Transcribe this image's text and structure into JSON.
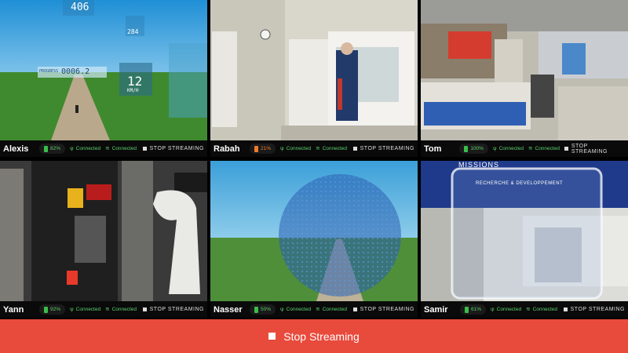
{
  "streams": [
    {
      "name": "Alexis",
      "battery": "82%",
      "battery_level": 0.82,
      "status_a": "Connected",
      "status_b": "Connected",
      "action": "STOP STREAMING"
    },
    {
      "name": "Rabah",
      "battery": "21%",
      "battery_level": 0.21,
      "status_a": "Connected",
      "status_b": "Connected",
      "action": "STOP STREAMING"
    },
    {
      "name": "Tom",
      "battery": "100%",
      "battery_level": 1.0,
      "status_a": "Connected",
      "status_b": "Connected",
      "action": "STOP STREAMING"
    },
    {
      "name": "Yann",
      "battery": "92%",
      "battery_level": 0.92,
      "status_a": "Connected",
      "status_b": "Connected",
      "action": "STOP STREAMING"
    },
    {
      "name": "Nasser",
      "battery": "50%",
      "battery_level": 0.5,
      "status_a": "Connected",
      "status_b": "Connected",
      "action": "STOP STREAMING"
    },
    {
      "name": "Samir",
      "battery": "61%",
      "battery_level": 0.61,
      "status_a": "Connected",
      "status_b": "Connected",
      "action": "STOP STREAMING"
    }
  ],
  "hud": {
    "top": "406",
    "right": "284",
    "progress_label": "PROGRESS",
    "progress_value": "0006.2",
    "speed": "12",
    "speed_unit": "KM/H"
  },
  "overlay_text": {
    "missions": "MISSIONS",
    "banner": "RECHERCHE & DEVELOPPEMENT"
  },
  "footer": {
    "label": "Stop Streaming"
  },
  "colors": {
    "accent": "#e84a3c",
    "ok": "#5bd16f",
    "warn": "#f07b2b"
  }
}
